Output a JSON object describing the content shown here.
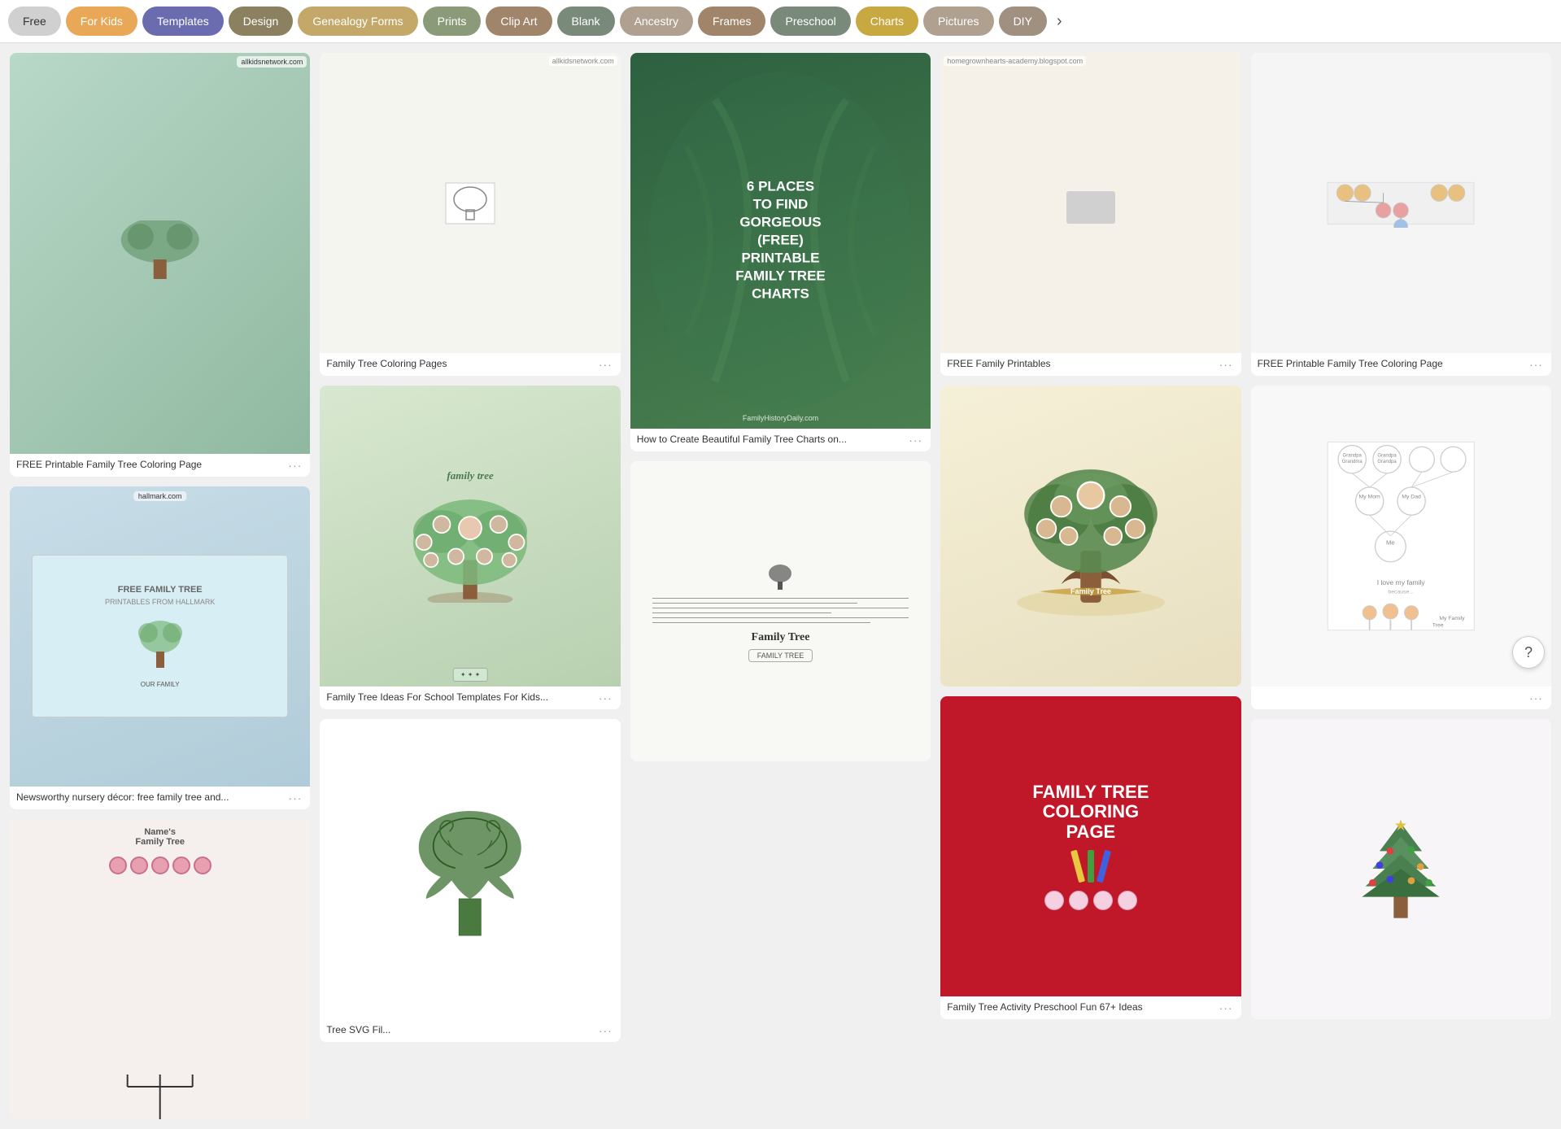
{
  "nav": {
    "items": [
      {
        "label": "Free",
        "style": "gray"
      },
      {
        "label": "For Kids",
        "style": "orange"
      },
      {
        "label": "Templates",
        "style": "active"
      },
      {
        "label": "Design",
        "style": "olive"
      },
      {
        "label": "Genealogy Forms",
        "style": "tan"
      },
      {
        "label": "Prints",
        "style": "sage"
      },
      {
        "label": "Clip Art",
        "style": "clay"
      },
      {
        "label": "Blank",
        "style": "slate"
      },
      {
        "label": "Ancestry",
        "style": "warm-gray"
      },
      {
        "label": "Frames",
        "style": "clay"
      },
      {
        "label": "Preschool",
        "style": "slate"
      },
      {
        "label": "Charts",
        "style": "gold"
      },
      {
        "label": "Pictures",
        "style": "warm-gray"
      },
      {
        "label": "DIY",
        "style": "taupe"
      }
    ],
    "arrow_label": "›"
  },
  "cards": [
    {
      "id": "card-free-printable-1",
      "title": "FREE Printable Family Tree Coloring Page",
      "col": 1,
      "theme": "light-blue-tree"
    },
    {
      "id": "card-free-family-tree-printables",
      "title": "Newsworthy nursery décor: free family tree and...",
      "col": 1,
      "theme": "light-blue-frame"
    },
    {
      "id": "card-names-family-tree",
      "title": "",
      "col": 1,
      "theme": "pink-names"
    },
    {
      "id": "card-family-tree-coloring-pages",
      "title": "Family Tree Coloring Pages",
      "col": 2,
      "theme": "white-bg"
    },
    {
      "id": "card-family-tree-ideas-school",
      "title": "Family Tree Ideas For School Templates For Kids...",
      "col": 2,
      "theme": "green-illustrated"
    },
    {
      "id": "card-tree-svg",
      "title": "Tree SVG Fil...",
      "col": 2,
      "theme": "white-scroll-tree"
    },
    {
      "id": "card-6-places",
      "title": "How to Create Beautiful Family Tree Charts on...",
      "col": 3,
      "theme": "green-dark-text",
      "overlay": "6 PLACES TO FIND GORGEOUS (FREE) PRINTABLE FAMILY TREE CHARTS",
      "source": "FamilyHistoryDaily.com"
    },
    {
      "id": "card-family-tree-blank",
      "title": "",
      "col": 3,
      "theme": "family-tree-blank"
    },
    {
      "id": "card-free-family-printables",
      "title": "FREE Family Printables",
      "col": 4,
      "theme": "blog-screenshot"
    },
    {
      "id": "card-illustrated-tree",
      "title": "",
      "col": 4,
      "theme": "illustrated-tree-yellow"
    },
    {
      "id": "card-coloring-page-red",
      "title": "FAMILY TREE COLORING PAGE",
      "col": 4,
      "theme": "red-bg"
    },
    {
      "id": "card-activity-preschool",
      "title": "Family Tree Activity Preschool Fun 67+ Ideas",
      "col": 5,
      "theme": "white-kids"
    },
    {
      "id": "card-free-printable-coloring-2",
      "title": "FREE Printable Family Tree Coloring Page",
      "col": 5,
      "theme": "white-coloring"
    },
    {
      "id": "card-christmas-tree",
      "title": "",
      "col": 5,
      "theme": "christmas-tree"
    }
  ],
  "help": {
    "label": "?"
  }
}
